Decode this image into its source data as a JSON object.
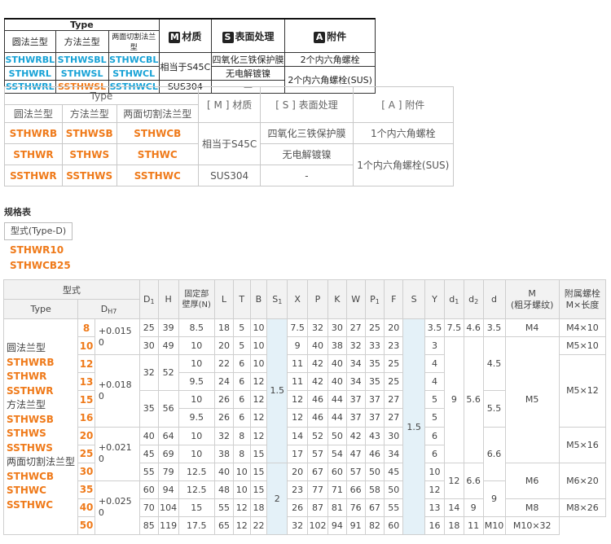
{
  "block1": {
    "type_label": "Type",
    "col_round": "圆法兰型",
    "col_square": "方法兰型",
    "col_twocut": "两面切割法兰型",
    "m_icon": "M",
    "m_label": "材质",
    "s_icon": "S",
    "s_label": "表面处理",
    "a_icon": "A",
    "a_label": "附件",
    "rows": [
      {
        "round": "STHWRBL",
        "square": "STHWSBL",
        "twocut": "STHWCBL"
      },
      {
        "round": "STHWRL",
        "square": "STHWSL",
        "twocut": "STHWCL"
      },
      {
        "round": "SSTHWRL",
        "square": "SSTHWSL",
        "twocut": "SSTHWCL"
      }
    ],
    "material_1": "相当于S45C",
    "material_2": "SUS304",
    "surface_1": "四氧化三铁保护膜",
    "surface_2": "无电解镀镍",
    "surface_3": "—",
    "attach_1": "2个内六角螺栓",
    "attach_2": "2个内六角螺栓(SUS)"
  },
  "block2": {
    "type_label": "Type",
    "col_round": "圆法兰型",
    "col_square": "方法兰型",
    "col_twocut": "两面切割法兰型",
    "m_label": "[ M ] 材质",
    "s_label": "[ S ] 表面处理",
    "a_label": "[ A ] 附件",
    "rows": [
      {
        "round": "STHWRB",
        "square": "STHWSB",
        "twocut": "STHWCB"
      },
      {
        "round": "STHWR",
        "square": "STHWS",
        "twocut": "STHWC"
      },
      {
        "round": "SSTHWR",
        "square": "SSTHWS",
        "twocut": "SSTHWC"
      }
    ],
    "material_1": "相当于S45C",
    "material_2": "SUS304",
    "surface_1": "四氧化三铁保护膜",
    "surface_2": "无电解镀镍",
    "surface_3": "-",
    "attach_1": "1个内六角螺栓",
    "attach_2": "1个内六角螺栓(SUS)"
  },
  "spec_title": "规格表",
  "type_d": "型式(Type-D)",
  "model_1": "STHWR10",
  "model_2": "STHWCB25",
  "spec": {
    "h_model": "型式",
    "h_type": "Type",
    "h_d1": "D",
    "h_d1_sub": "1",
    "h_h": "H",
    "h_wall": "固定部\n壁厚(N)",
    "h_l": "L",
    "h_t": "T",
    "h_b": "B",
    "h_s1": "S",
    "h_s1_sub": "1",
    "h_x": "X",
    "h_p": "P",
    "h_k": "K",
    "h_w": "W",
    "h_p1": "P",
    "h_p1_sub": "1",
    "h_f": "F",
    "h_s": "S",
    "h_y": "Y",
    "h_sd1": "d",
    "h_sd1_sub": "1",
    "h_sd2": "d",
    "h_sd2_sub": "2",
    "h_d": "d",
    "h_m": "M\n(粗牙螺纹)",
    "h_bolt": "附属螺栓\nM×长度",
    "h_dh": "D",
    "h_dh_sub": "H7",
    "types": [
      "圆法兰型",
      "STHWRB",
      "STHWR",
      "SSTHWR",
      "方法兰型",
      "STHWSB",
      "STHWS",
      "SSTHWS",
      "两面切割法兰型",
      "STHWCB",
      "STHWC",
      "SSTHWC"
    ],
    "tol_1": "+0.015\n0",
    "tol_2": "+0.018\n0",
    "tol_3": "+0.021\n0",
    "tol_4": "+0.025\n0",
    "s1_a": "1.5",
    "s1_b": "2",
    "s_val": "1.5",
    "rows": [
      {
        "dh": "8",
        "d1": "25",
        "h": "39",
        "n": "8.5",
        "l": "18",
        "t": "5",
        "b": "10",
        "x": "7.5",
        "p": "32",
        "k": "30",
        "w": "27",
        "p1": "25",
        "f": "20",
        "y": "3.5"
      },
      {
        "dh": "10",
        "d1": "30",
        "h": "49",
        "n": "10",
        "l": "20",
        "t": "5",
        "b": "10",
        "x": "9",
        "p": "40",
        "k": "38",
        "w": "32",
        "p1": "33",
        "f": "23",
        "y": "3"
      },
      {
        "dh": "12",
        "n": "10",
        "l": "22",
        "t": "6",
        "b": "10",
        "x": "11",
        "p": "42",
        "k": "40",
        "w": "34",
        "p1": "35",
        "f": "25",
        "y": "4"
      },
      {
        "dh": "13",
        "n": "9.5",
        "l": "24",
        "t": "6",
        "b": "12",
        "x": "11",
        "p": "42",
        "k": "40",
        "w": "34",
        "p1": "35",
        "f": "25",
        "y": "4"
      },
      {
        "dh": "15",
        "n": "10",
        "l": "26",
        "t": "6",
        "b": "12",
        "x": "12",
        "p": "46",
        "k": "44",
        "w": "37",
        "p1": "37",
        "f": "27",
        "y": "5"
      },
      {
        "dh": "16",
        "n": "9.5",
        "l": "26",
        "t": "6",
        "b": "12",
        "x": "12",
        "p": "46",
        "k": "44",
        "w": "37",
        "p1": "37",
        "f": "27",
        "y": "5"
      },
      {
        "dh": "20",
        "d1": "40",
        "h": "64",
        "n": "10",
        "l": "32",
        "t": "8",
        "b": "12",
        "x": "14",
        "p": "52",
        "k": "50",
        "w": "42",
        "p1": "43",
        "f": "30",
        "y": "6"
      },
      {
        "dh": "25",
        "d1": "45",
        "h": "69",
        "n": "10",
        "l": "38",
        "t": "8",
        "b": "15",
        "x": "17",
        "p": "57",
        "k": "54",
        "w": "47",
        "p1": "46",
        "f": "34",
        "y": "6"
      },
      {
        "dh": "30",
        "d1": "55",
        "h": "79",
        "n": "12.5",
        "l": "40",
        "t": "10",
        "b": "15",
        "x": "20",
        "p": "67",
        "k": "60",
        "w": "57",
        "p1": "50",
        "f": "45",
        "y": "10"
      },
      {
        "dh": "35",
        "d1": "60",
        "h": "94",
        "n": "12.5",
        "l": "48",
        "t": "10",
        "b": "15",
        "x": "23",
        "p": "77",
        "k": "71",
        "w": "66",
        "p1": "58",
        "f": "50",
        "y": "12"
      },
      {
        "dh": "40",
        "d1": "70",
        "h": "104",
        "n": "15",
        "l": "55",
        "t": "12",
        "b": "18",
        "x": "26",
        "p": "87",
        "k": "81",
        "w": "76",
        "p1": "67",
        "f": "55",
        "y": "13"
      },
      {
        "dh": "50",
        "d1": "85",
        "h": "119",
        "n": "17.5",
        "l": "65",
        "t": "12",
        "b": "22",
        "x": "32",
        "p": "102",
        "k": "94",
        "w": "91",
        "p1": "82",
        "f": "60",
        "y": "16"
      }
    ],
    "d1_32": "32",
    "h_52": "52",
    "d1_35": "35",
    "h_56": "56",
    "sd1_75": "7.5",
    "sd2_46": "4.6",
    "d_35": "3.5",
    "sd1_9": "9",
    "sd2_56": "5.6",
    "d_45": "4.5",
    "d_55": "5.5",
    "d_66": "6.6",
    "sd1_12": "12",
    "sd2_66": "6.6",
    "d_9": "9",
    "sd1_14": "14",
    "sd1_18": "18",
    "sd2_11": "11",
    "m_m4": "M4",
    "m_m5": "M5",
    "m_m6": "M6",
    "m_m8": "M8",
    "m_m10": "M10",
    "b_4x10": "M4×10",
    "b_5x10": "M5×10",
    "b_5x12": "M5×12",
    "b_5x16": "M5×16",
    "b_6x20": "M6×20",
    "b_8x26": "M8×26",
    "b_10x32": "M10×32"
  }
}
